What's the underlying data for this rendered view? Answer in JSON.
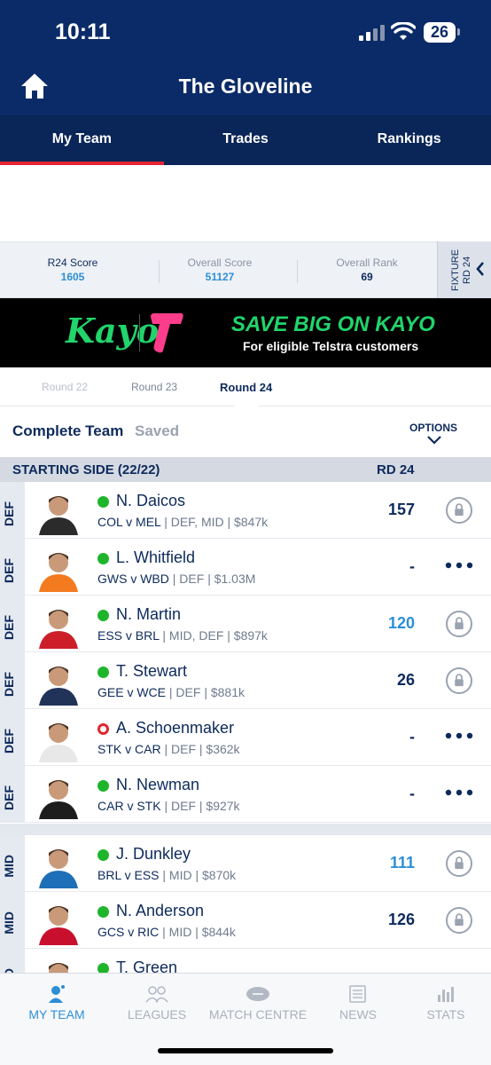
{
  "status_bar": {
    "time": "10:11",
    "battery": "26"
  },
  "header": {
    "title": "The Gloveline"
  },
  "tabs": [
    {
      "label": "My Team",
      "active": true
    },
    {
      "label": "Trades",
      "active": false
    },
    {
      "label": "Rankings",
      "active": false
    }
  ],
  "stats": {
    "r24_score_label": "R24 Score",
    "r24_score": "1605",
    "overall_score_label": "Overall Score",
    "overall_score": "51127",
    "overall_rank_label": "Overall Rank",
    "overall_rank": "69",
    "fixture_label": "FIXTURE RD 24"
  },
  "ad": {
    "brand": "Kayo",
    "headline": "SAVE BIG ON KAYO",
    "subline": "For eligible Telstra customers"
  },
  "rounds": [
    {
      "label": "Round 22"
    },
    {
      "label": "Round 23"
    },
    {
      "label": "Round 24",
      "active": true
    }
  ],
  "team": {
    "complete_label": "Complete Team",
    "saved_label": "Saved",
    "options_label": "OPTIONS"
  },
  "section": {
    "title": "STARTING SIDE (22/22)",
    "round": "RD 24"
  },
  "players": [
    {
      "pos": "DEF",
      "name": "N. Daicos",
      "match": "COL v MEL",
      "details": " | DEF, MID | $847k",
      "score": "157",
      "status": "playing",
      "action": "lock",
      "live": false
    },
    {
      "pos": "DEF",
      "name": "L. Whitfield",
      "match": "GWS v WBD",
      "details": " | DEF | $1.03M",
      "score": "-",
      "status": "playing",
      "action": "more",
      "live": false
    },
    {
      "pos": "DEF",
      "name": "N. Martin",
      "match": "ESS v BRL",
      "details": " | MID, DEF | $897k",
      "score": "120",
      "status": "playing",
      "action": "lock",
      "live": true
    },
    {
      "pos": "DEF",
      "name": "T. Stewart",
      "match": "GEE v WCE",
      "details": " | DEF | $881k",
      "score": "26",
      "status": "playing",
      "action": "lock",
      "live": false
    },
    {
      "pos": "DEF",
      "name": "A. Schoenmaker",
      "match": "STK v CAR",
      "details": " | DEF | $362k",
      "score": "-",
      "status": "doubt",
      "action": "more",
      "live": false
    },
    {
      "pos": "DEF",
      "name": "N. Newman",
      "match": "CAR v STK",
      "details": " | DEF | $927k",
      "score": "-",
      "status": "playing",
      "action": "more",
      "live": false
    },
    {
      "pos": "MID",
      "name": "J. Dunkley",
      "match": "BRL v ESS",
      "details": " | MID | $870k",
      "score": "111",
      "status": "playing",
      "action": "lock",
      "live": true
    },
    {
      "pos": "MID",
      "name": "N. Anderson",
      "match": "GCS v RIC",
      "details": " | MID | $844k",
      "score": "126",
      "status": "playing",
      "action": "lock",
      "live": false
    },
    {
      "pos": "MID",
      "name": "T. Green",
      "match": "",
      "details": "",
      "score": "",
      "status": "playing",
      "action": "",
      "live": false
    }
  ],
  "bottom_nav": [
    {
      "label": "MY TEAM",
      "icon": "person-icon",
      "active": true
    },
    {
      "label": "LEAGUES",
      "icon": "people-icon",
      "active": false
    },
    {
      "label": "MATCH CENTRE",
      "icon": "football-icon",
      "active": false
    },
    {
      "label": "NEWS",
      "icon": "news-icon",
      "active": false
    },
    {
      "label": "STATS",
      "icon": "bar-chart-icon",
      "active": false
    }
  ],
  "colors": {
    "navy": "#0b2b68",
    "accent_red": "#e32434",
    "live_blue": "#2d8ed6",
    "playing_green": "#1fb52b"
  }
}
